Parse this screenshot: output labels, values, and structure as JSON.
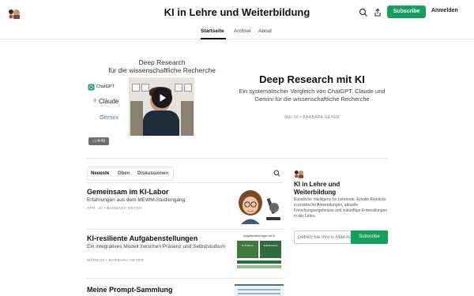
{
  "header": {
    "site_title": "KI in Lehre und Weiterbildung",
    "subscribe_label": "Subscribe",
    "signin_label": "Anmelden"
  },
  "nav": {
    "items": [
      "Startseite",
      "Archive",
      "About"
    ]
  },
  "hero": {
    "thumbnail": {
      "heading_line1": "Deep Research",
      "heading_line2": "für die wissenschaftliche Recherche",
      "brands": [
        "ChatGPT",
        "Claude",
        "Gemini"
      ],
      "duration": "4:49"
    },
    "title": "Deep Research mit KI",
    "subtitle": "Ein systematischer Vergleich von ChatGPT, Claude und Gemini für die wissenschaftliche Recherche",
    "meta": "MAI 30 • BARBARA GEYER"
  },
  "tabs": [
    "Neueste",
    "Oben",
    "Diskussionen"
  ],
  "posts": [
    {
      "title": "Gemeinsam im KI-Labor",
      "subtitle": "Erfahrungen aus dem MEWM-Studiengang",
      "meta": "APR. 30 • BARBARA GEYER"
    },
    {
      "title": "KI-resiliente Aufgabenstellungen",
      "subtitle": "Ein integratives Modell zwischen Präsenz und Selbststudium",
      "meta": "MÄRZ 25 • BARBARA GEYER",
      "thumb_heading": "Aufgabenstellungen mit KI",
      "thumb_box1": "KI-Präsenz",
      "thumb_box2": "Selbststudium"
    },
    {
      "title": "Meine Prompt-Sammlung"
    }
  ],
  "sidebar": {
    "title": "KI in Lehre und Weiterbildung",
    "description": "Künstliche Intelligenz für Lehrende. Erhalte Einblicke in praktische Anwendungen, aktuelle Forschungsergebnisse und zukünftige Entwicklungen in der Lehre.",
    "email_placeholder": "Geben Sie Ihre E-Mail-Adresse ein",
    "subscribe_label": "Subscribe"
  },
  "colors": {
    "accent": "#12a05c"
  }
}
